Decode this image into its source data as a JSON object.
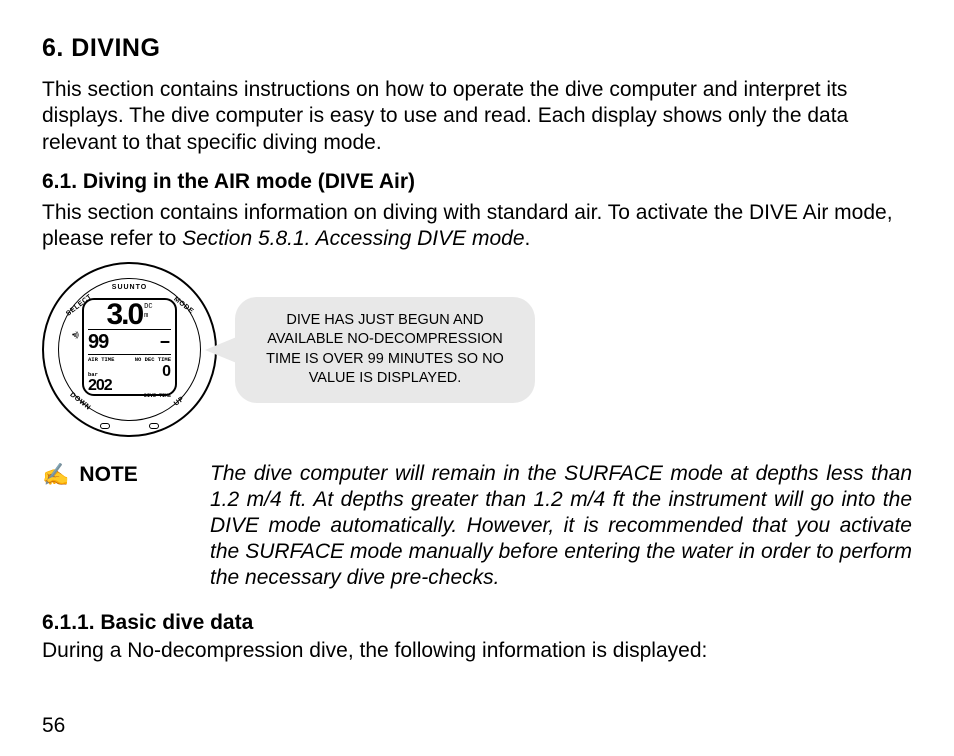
{
  "heading": "6.  DIVING",
  "intro": "This section contains instructions on how to operate the dive computer and interpret its displays. The dive computer is easy to use and read. Each display shows only the data relevant to that specific diving mode.",
  "sub1_heading": "6.1. Diving in the AIR mode (DIVE Air)",
  "sub1_text_a": "This section contains information on diving with standard air. To activate the DIVE Air mode, please refer to ",
  "sub1_text_ref": "Section 5.8.1. Accessing DIVE mode",
  "sub1_text_b": ".",
  "watch": {
    "brand": "SUUNTO",
    "depth": "3.0",
    "depth_unit_top": "DC",
    "depth_unit": "m",
    "val_left": "99",
    "val_dash": "–",
    "label_airtime": "AIR TIME",
    "label_nodec": "NO DEC TIME",
    "label_bar": "bar",
    "val_202": "202",
    "val_0": "0",
    "label_divetime": "DIVE TIME",
    "btn_select": "SELECT",
    "btn_mode": "MODE",
    "btn_down": "DOWN",
    "btn_up": "UP",
    "signal": "•ıı))"
  },
  "callout": "DIVE HAS JUST BEGUN AND AVAILABLE NO-DECOMPRESSION TIME IS OVER 99 MINUTES SO NO VALUE IS DISPLAYED.",
  "note_label": "NOTE",
  "note_body": "The dive computer will remain in the SURFACE mode at depths less than 1.2 m/4 ft. At depths greater than 1.2 m/4 ft the instrument will go into the DIVE mode automatically. However, it is recommended that you activate the SURFACE mode manually before entering the water in order to perform the necessary dive pre-checks.",
  "sub2_heading": "6.1.1. Basic dive data",
  "sub2_text": "During a No-decompression dive, the following information is displayed:",
  "page_number": "56"
}
